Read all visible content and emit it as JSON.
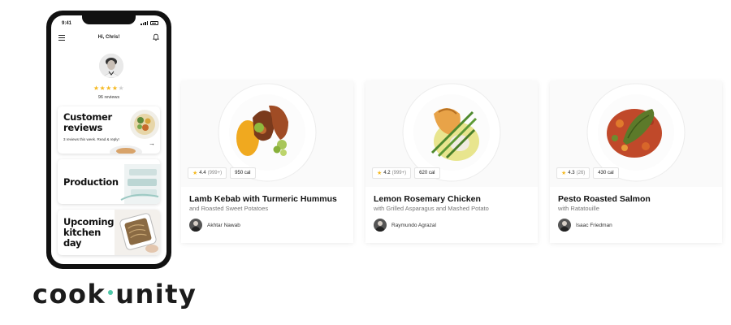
{
  "phone": {
    "status_time": "9:41",
    "greeting": "Hi, Chris!",
    "rating_stars": 4,
    "rating_stars_total": 5,
    "reviews_count": "96 reviews",
    "promos": [
      {
        "title": "Customer reviews",
        "subtitle": "3 reviews this week. Read & reply!",
        "arrow": "→"
      },
      {
        "title": "Production"
      },
      {
        "title": "Upcoming kitchen day"
      }
    ]
  },
  "logo": {
    "left": "cook",
    "right": "unity",
    "dot_color": "#4ec7a8"
  },
  "meals": [
    {
      "title": "Lamb Kebab with Turmeric Hummus",
      "subtitle": "and Roasted Sweet Potatoes",
      "rating": "4.4",
      "rating_count": "(999+)",
      "calories": "950 cal",
      "chef": "Akhtar Nawab"
    },
    {
      "title": "Lemon Rosemary Chicken",
      "subtitle": "with Grilled Asparagus and Mashed Potato",
      "rating": "4.2",
      "rating_count": "(999+)",
      "calories": "620 cal",
      "chef": "Raymundo Agrazal"
    },
    {
      "title": "Pesto Roasted Salmon",
      "subtitle": "with Ratatouille",
      "rating": "4.3",
      "rating_count": "(26)",
      "calories": "430 cal",
      "chef": "Isaac Friedman"
    }
  ],
  "colors": {
    "star": "#f5b921",
    "accent": "#4ec7a8",
    "text": "#1c1c1c"
  },
  "icons": [
    "menu-icon",
    "bell-icon",
    "arrow-right-icon",
    "star-icon"
  ]
}
